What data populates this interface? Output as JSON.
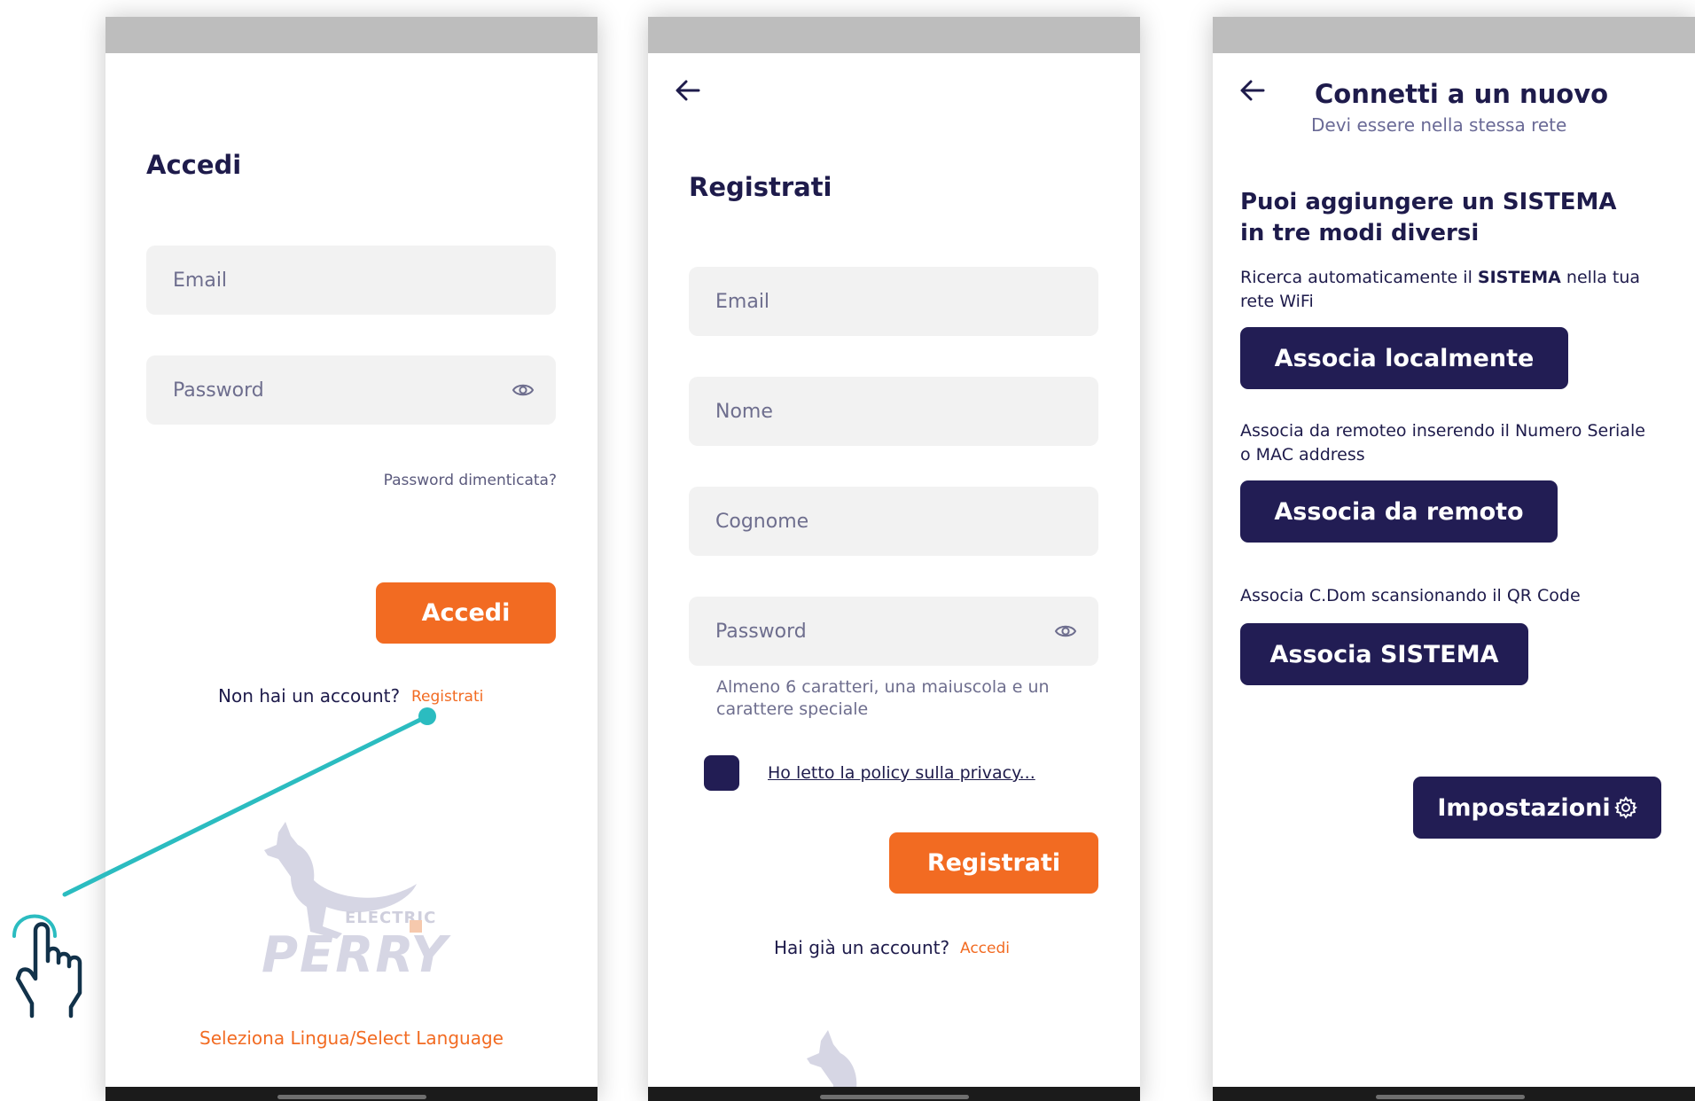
{
  "login": {
    "title": "Accedi",
    "email_placeholder": "Email",
    "password_placeholder": "Password",
    "forgot_label": "Password dimenticata?",
    "submit_label": "Accedi",
    "no_account_text": "Non hai un account?",
    "register_link": "Registrati",
    "language_label": "Seleziona Lingua/Select Language",
    "logo_text_small": "ELECTRIC",
    "logo_text_large": "PERRY"
  },
  "register": {
    "title": "Registrati",
    "email_placeholder": "Email",
    "name_placeholder": "Nome",
    "surname_placeholder": "Cognome",
    "password_placeholder": "Password",
    "password_hint": "Almeno 6 caratteri, una maiuscola e un carattere speciale",
    "privacy_label": "Ho letto la policy sulla privacy...",
    "submit_label": "Registrati",
    "have_account_text": "Hai già un account?",
    "login_link": "Accedi"
  },
  "connect": {
    "title": "Connetti a un nuovo",
    "subtitle": "Devi essere nella stessa rete",
    "intro": "Puoi aggiungere un SISTEMA in tre modi diversi",
    "intro_line1_prefix": "Puoi aggiungere un ",
    "intro_line1_strong": "SISTEMA",
    "intro_line2": "in tre modi diversi",
    "local_desc_prefix": "Ricerca automaticamente il ",
    "local_desc_strong": "SISTEMA",
    "local_desc_suffix": " nella tua",
    "local_desc_line2": "rete WiFi",
    "local_button": "Associa localmente",
    "remote_desc_line1": "Associa da remoteo inserendo il Numero Seriale",
    "remote_desc_line2": "o MAC address",
    "remote_button": "Associa da remoto",
    "qr_desc": "Associa C.Dom scansionando il QR Code",
    "qr_button": "Associa SISTEMA",
    "settings_button": "Impostazioni"
  },
  "colors": {
    "accent_orange": "#f26b22",
    "navy": "#221d54",
    "field_bg": "#f2f2f2",
    "pointer_line": "#2bbcc0"
  }
}
